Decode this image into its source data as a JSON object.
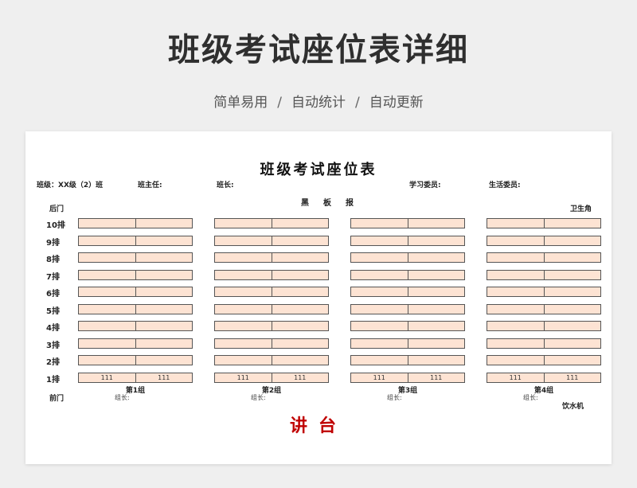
{
  "header": {
    "title": "班级考试座位表详细",
    "tagline": [
      "简单易用",
      "自动统计",
      "自动更新"
    ],
    "separator": "/"
  },
  "sheet": {
    "title": "班级考试座位表",
    "info": {
      "class": "班级：XX级（2）班",
      "head_teacher": "班主任:",
      "monitor": "班长:",
      "study_rep": "学习委员:",
      "life_rep": "生活委员:"
    },
    "blackboard": "黑　板　报",
    "back_door": "后门",
    "front_door": "前门",
    "sanitation_corner": "卫生角",
    "water_dispenser": "饮水机",
    "podium": "讲台",
    "rows": [
      "10排",
      "9排",
      "8排",
      "7排",
      "6排",
      "5排",
      "4排",
      "3排",
      "2排",
      "1排"
    ],
    "groups": [
      {
        "name": "第1组",
        "leader": "组长:"
      },
      {
        "name": "第2组",
        "leader": "组长:"
      },
      {
        "name": "第3组",
        "leader": "组长:"
      },
      {
        "name": "第4组",
        "leader": "组长:"
      }
    ],
    "front_row_seat_value": "111"
  }
}
